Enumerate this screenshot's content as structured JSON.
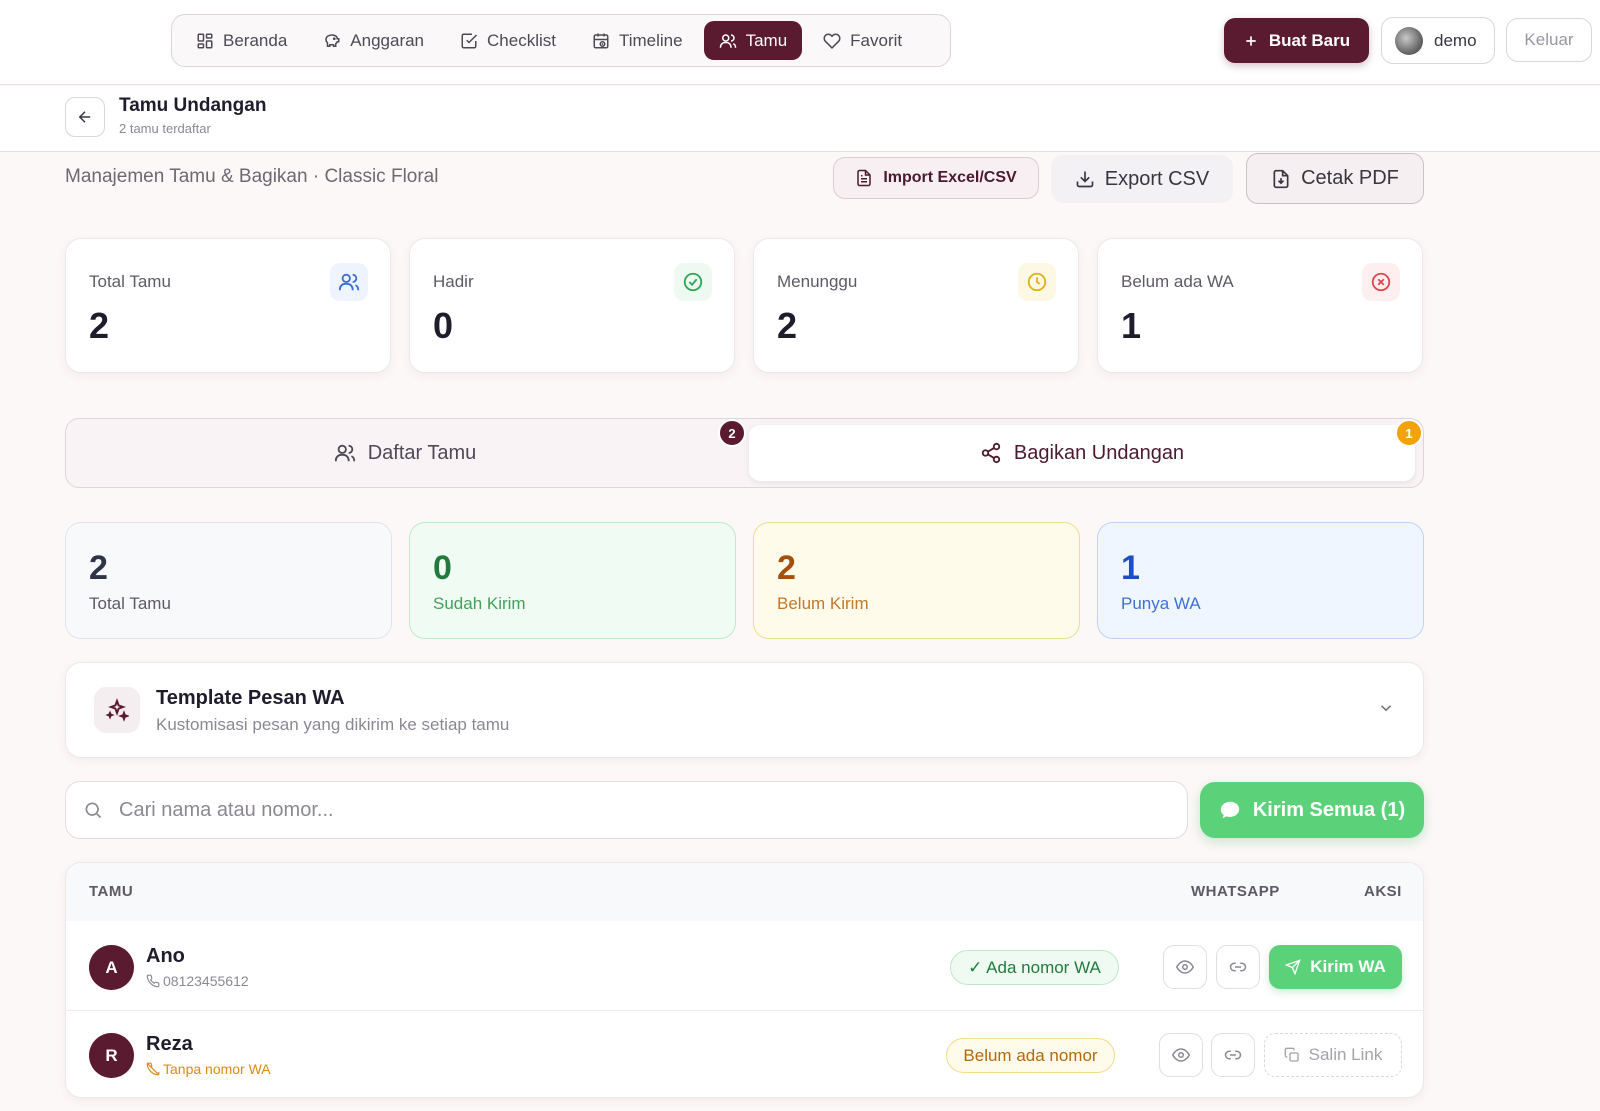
{
  "nav": {
    "items": [
      {
        "label": "Beranda",
        "icon": "grid-icon"
      },
      {
        "label": "Anggaran",
        "icon": "piggy-bank-icon"
      },
      {
        "label": "Checklist",
        "icon": "checkbox-icon"
      },
      {
        "label": "Timeline",
        "icon": "calendar-clock-icon"
      },
      {
        "label": "Tamu",
        "icon": "users-icon",
        "active": true
      },
      {
        "label": "Favorit",
        "icon": "heart-icon"
      }
    ],
    "new_button": "Buat Baru",
    "user_name": "demo",
    "logout": "Keluar"
  },
  "header": {
    "title": "Tamu Undangan",
    "subtitle": "2 tamu terdaftar"
  },
  "section": {
    "label": "Manajemen Tamu & Bagikan · Classic Floral",
    "import_label": "Import Excel/CSV",
    "export_label": "Export CSV",
    "pdf_label": "Cetak PDF"
  },
  "stats": [
    {
      "label": "Total Tamu",
      "value": "2",
      "icon": "users-icon",
      "color": "#3b6fd4"
    },
    {
      "label": "Hadir",
      "value": "0",
      "icon": "check-circle-icon",
      "color": "#2fa85a"
    },
    {
      "label": "Menunggu",
      "value": "2",
      "icon": "clock-icon",
      "color": "#e0b21a"
    },
    {
      "label": "Belum ada WA",
      "value": "1",
      "icon": "x-circle-icon",
      "color": "#e0484f"
    }
  ],
  "tabs": [
    {
      "label": "Daftar Tamu",
      "badge": "2"
    },
    {
      "label": "Bagikan Undangan",
      "badge": "1",
      "active": true
    }
  ],
  "share_stats": [
    {
      "value": "2",
      "label": "Total Tamu"
    },
    {
      "value": "0",
      "label": "Sudah Kirim"
    },
    {
      "value": "2",
      "label": "Belum Kirim"
    },
    {
      "value": "1",
      "label": "Punya WA"
    }
  ],
  "template": {
    "title": "Template Pesan WA",
    "subtitle": "Kustomisasi pesan yang dikirim ke setiap tamu"
  },
  "search": {
    "placeholder": "Cari nama atau nomor...",
    "value": ""
  },
  "send_all": "Kirim Semua (1)",
  "table": {
    "columns": [
      "TAMU",
      "WHATSAPP",
      "AKSI"
    ],
    "rows": [
      {
        "initial": "A",
        "name": "Ano",
        "phone": "08123455612",
        "wa_status": "✓ Ada nomor WA",
        "action": "Kirim WA"
      },
      {
        "initial": "R",
        "name": "Reza",
        "phone": "Tanpa nomor WA",
        "wa_status": "Belum ada nomor",
        "action": "Salin Link"
      }
    ]
  },
  "colors": {
    "brand": "#5a1a30",
    "whatsapp_green": "#5bd27a",
    "badge_orange": "#f2a20c"
  }
}
